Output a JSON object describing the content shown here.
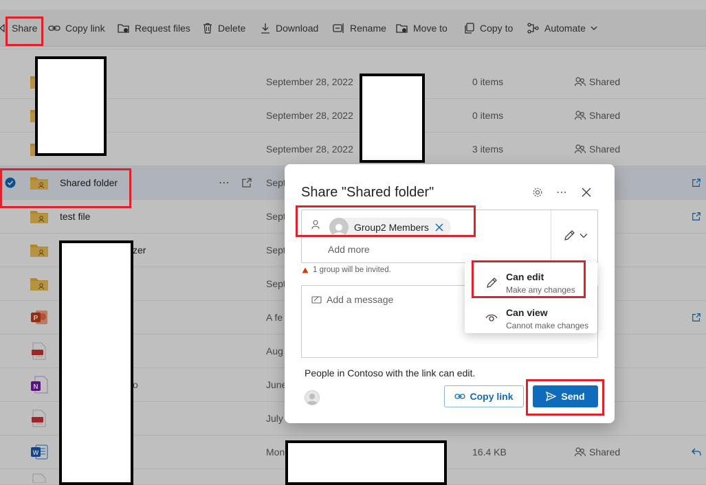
{
  "toolbar": {
    "items": [
      {
        "label": "Share",
        "icon": "share-icon"
      },
      {
        "label": "Copy link",
        "icon": "link-icon"
      },
      {
        "label": "Request files",
        "icon": "request-files-icon"
      },
      {
        "label": "Delete",
        "icon": "trash-icon"
      },
      {
        "label": "Download",
        "icon": "download-icon"
      },
      {
        "label": "Rename",
        "icon": "rename-icon"
      },
      {
        "label": "Move to",
        "icon": "move-icon"
      },
      {
        "label": "Copy to",
        "icon": "copy-icon"
      },
      {
        "label": "Automate",
        "icon": "automate-icon"
      }
    ]
  },
  "files": [
    {
      "name": "",
      "modified": "September 28, 2022",
      "size": "0 items",
      "sharing": "Shared",
      "type": "folder"
    },
    {
      "name": "",
      "modified": "September 28, 2022",
      "size": "0 items",
      "sharing": "Shared",
      "type": "folder"
    },
    {
      "name": "",
      "modified": "September 28, 2022",
      "size": "3 items",
      "sharing": "Shared",
      "type": "folder"
    },
    {
      "name": "Shared folder",
      "modified": "Sept",
      "size": "",
      "sharing": "",
      "type": "shared-folder",
      "selected": true
    },
    {
      "name": "test file",
      "modified": "Sept",
      "size": "",
      "sharing": "",
      "type": "shared-folder"
    },
    {
      "name": "zer",
      "modified": "Sept",
      "size": "",
      "sharing": "",
      "type": "shared-folder"
    },
    {
      "name": "",
      "modified": "Sept",
      "size": "",
      "sharing": "",
      "type": "shared-folder"
    },
    {
      "name": "",
      "modified": "A fe",
      "size": "",
      "sharing": "",
      "type": "powerpoint"
    },
    {
      "name": "",
      "modified": "Aug",
      "size": "",
      "sharing": "",
      "type": "pdf"
    },
    {
      "name": "",
      "modified": "June",
      "size": "",
      "sharing": "",
      "type": "onenote"
    },
    {
      "name": "",
      "modified": "July",
      "size": "",
      "sharing": "",
      "type": "pdf"
    },
    {
      "name": "",
      "modified": "Mon",
      "size": "16.4 KB",
      "sharing": "Shared",
      "type": "word"
    }
  ],
  "dialog": {
    "title": "Share \"Shared folder\"",
    "recipient_chip": "Group2 Members",
    "add_more_placeholder": "Add more",
    "warning": "1 group will be invited.",
    "message_placeholder": "Add a message",
    "link_description": "People in Contoso with the link can edit.",
    "copy_link_label": "Copy link",
    "send_label": "Send"
  },
  "permission_menu": {
    "options": [
      {
        "title": "Can edit",
        "subtitle": "Make any changes",
        "icon": "pencil-icon"
      },
      {
        "title": "Can view",
        "subtitle": "Cannot make changes",
        "icon": "eye-icon"
      }
    ]
  },
  "colors": {
    "accent": "#0f6cbd",
    "highlight": "#e0212c",
    "folder": "#e8b33c",
    "selected_row": "#eaf0f8"
  }
}
